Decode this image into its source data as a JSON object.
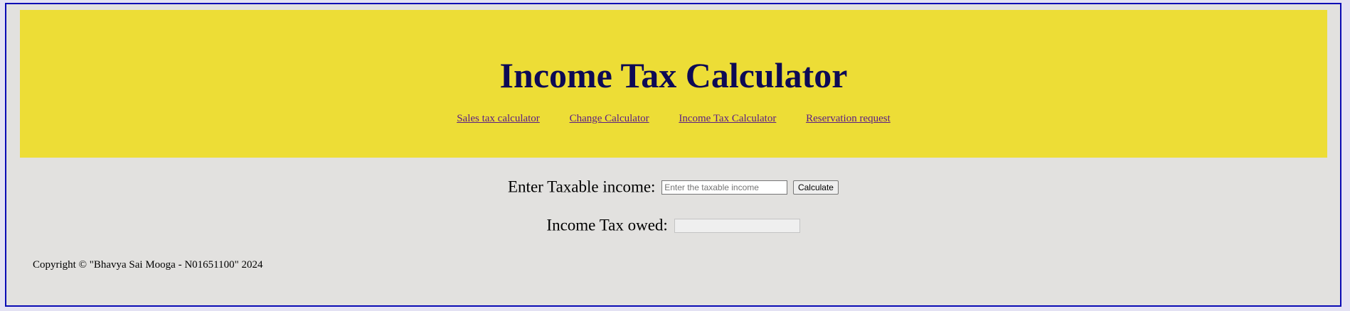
{
  "header": {
    "title": "Income Tax Calculator",
    "nav": [
      {
        "label": "Sales tax calculator"
      },
      {
        "label": "Change Calculator"
      },
      {
        "label": "Income Tax Calculator"
      },
      {
        "label": "Reservation request"
      }
    ]
  },
  "form": {
    "income_label": "Enter Taxable income:",
    "income_placeholder": "Enter the taxable income",
    "income_value": "",
    "calculate_label": "Calculate",
    "owed_label": "Income Tax owed:",
    "owed_value": ""
  },
  "footer": {
    "copyright": "Copyright © \"Bhavya Sai Mooga - N01651100\" 2024"
  },
  "colors": {
    "header_bg": "#eddd36",
    "title": "#0d0a55",
    "link": "#5a1c85",
    "frame_border": "#0a0ab4",
    "page_bg": "#e2e1df"
  }
}
